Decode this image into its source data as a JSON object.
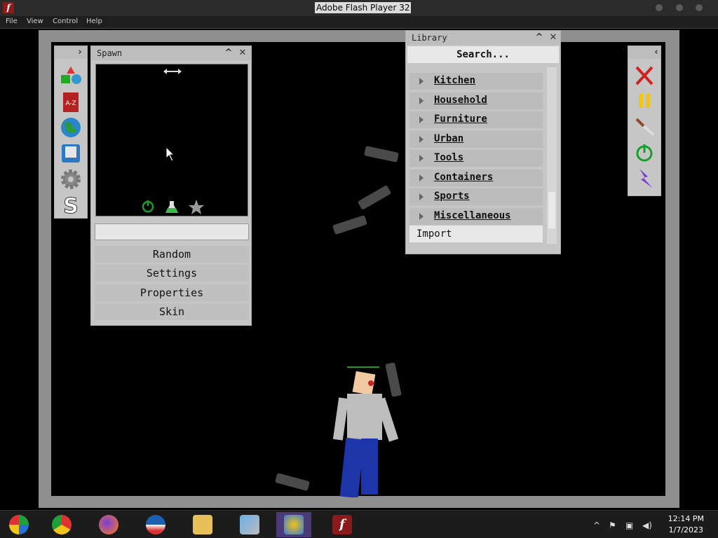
{
  "window": {
    "title": "Adobe Flash Player 32",
    "menu": [
      "File",
      "View",
      "Control",
      "Help"
    ]
  },
  "spawn_panel": {
    "title": "Spawn",
    "buttons": [
      "Random",
      "Settings",
      "Properties",
      "Skin"
    ]
  },
  "left_toolbar": {
    "icons": [
      "shapes-icon",
      "a-z-book-icon",
      "globe-icon",
      "save-disk-icon",
      "gear-icon",
      "s-logo-icon"
    ]
  },
  "library_panel": {
    "title": "Library",
    "search_placeholder": "Search...",
    "categories": [
      "Kitchen",
      "Household",
      "Furniture",
      "Urban",
      "Tools",
      "Containers",
      "Sports",
      "Miscellaneous"
    ],
    "import_label": "Import"
  },
  "right_toolbar": {
    "icons": [
      "close-x-icon",
      "pause-icon",
      "knife-icon",
      "power-icon",
      "lightning-icon"
    ]
  },
  "taskbar": {
    "apps": [
      "windows-media-center-icon",
      "chrome-icon",
      "firefox-icon",
      "obama-logo-icon",
      "file-explorer-icon",
      "control-panel-icon",
      "people-icon",
      "flash-player-icon"
    ],
    "time": "12:14 PM",
    "date": "1/7/2023"
  },
  "colors": {
    "panel": "#c6c6c6",
    "stage_border": "#8f8f8f",
    "accent_green": "#1a9e2a",
    "accent_red": "#cc2222"
  }
}
